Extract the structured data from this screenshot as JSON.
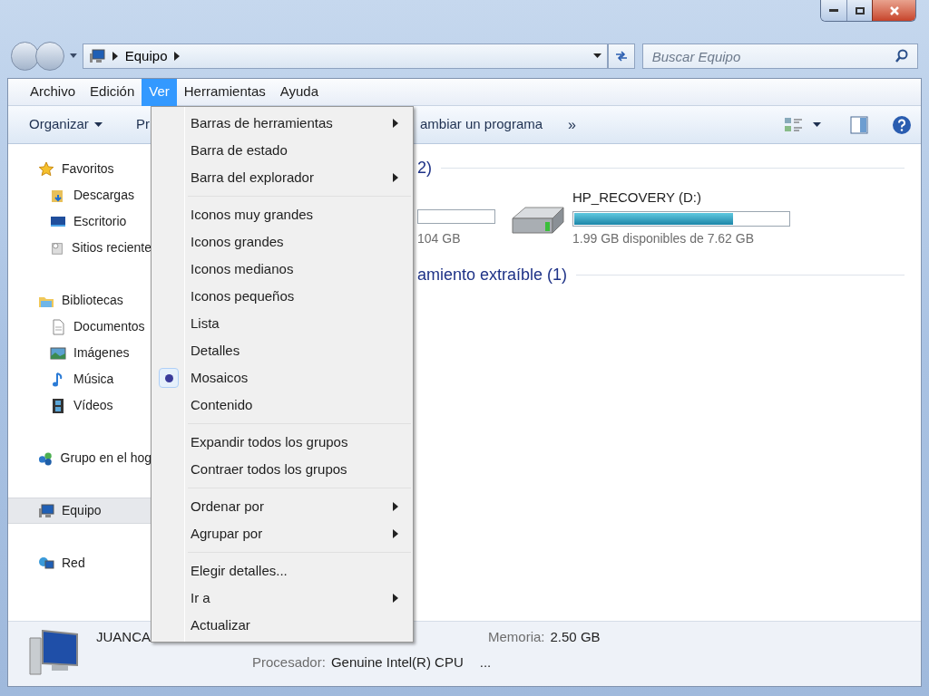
{
  "address": {
    "crumbs": [
      "Equipo"
    ]
  },
  "search": {
    "placeholder": "Buscar Equipo"
  },
  "menubar": [
    {
      "label": "Archivo",
      "selected": false
    },
    {
      "label": "Edición",
      "selected": false
    },
    {
      "label": "Ver",
      "selected": true
    },
    {
      "label": "Herramientas",
      "selected": false
    },
    {
      "label": "Ayuda",
      "selected": false
    }
  ],
  "toolbar": [
    {
      "label": "Organizar",
      "kind": "dropdown"
    },
    {
      "label": "Pr",
      "kind": "text"
    },
    {
      "label": "ambiar un programa",
      "kind": "text"
    },
    {
      "label": "»",
      "kind": "more"
    }
  ],
  "sidebar": [
    {
      "label": "Favoritos",
      "kind": "star",
      "selected": false,
      "children": [
        {
          "label": "Descargas",
          "kind": "download",
          "selected": false
        },
        {
          "label": "Escritorio",
          "kind": "desktop",
          "selected": false
        },
        {
          "label": "Sitios reciente",
          "kind": "recent",
          "selected": false
        }
      ]
    },
    {
      "label": "Bibliotecas",
      "kind": "library",
      "selected": false,
      "children": [
        {
          "label": "Documentos",
          "kind": "document",
          "selected": false
        },
        {
          "label": "Imágenes",
          "kind": "image",
          "selected": false
        },
        {
          "label": "Música",
          "kind": "music",
          "selected": false
        },
        {
          "label": "Vídeos",
          "kind": "video",
          "selected": false
        }
      ]
    },
    {
      "label": "Grupo en el hog",
      "kind": "homegroup",
      "selected": false
    },
    {
      "label": "Equipo",
      "kind": "computer",
      "selected": true
    },
    {
      "label": "Red",
      "kind": "network",
      "selected": false
    }
  ],
  "content": {
    "groups": [
      {
        "heading": "2)",
        "drives": [
          {
            "kind": "fragment",
            "info": "104 GB"
          },
          {
            "kind": "drive",
            "name": "HP_RECOVERY (D:)",
            "level": 0.74,
            "info": "1.99 GB disponibles de 7.62 GB"
          }
        ]
      },
      {
        "heading": "amiento extraíble (1)"
      }
    ]
  },
  "menu": [
    {
      "kind": "item",
      "label": "Barras de herramientas",
      "submenu": true,
      "selected": false
    },
    {
      "kind": "item",
      "label": "Barra de estado",
      "submenu": false,
      "selected": false
    },
    {
      "kind": "item",
      "label": "Barra del explorador",
      "submenu": true,
      "selected": false
    },
    {
      "kind": "separator"
    },
    {
      "kind": "item",
      "label": "Iconos muy grandes",
      "submenu": false,
      "selected": false
    },
    {
      "kind": "item",
      "label": "Iconos grandes",
      "submenu": false,
      "selected": false
    },
    {
      "kind": "item",
      "label": "Iconos medianos",
      "submenu": false,
      "selected": false
    },
    {
      "kind": "item",
      "label": "Iconos pequeños",
      "submenu": false,
      "selected": false
    },
    {
      "kind": "item",
      "label": "Lista",
      "submenu": false,
      "selected": false
    },
    {
      "kind": "item",
      "label": "Detalles",
      "submenu": false,
      "selected": false
    },
    {
      "kind": "item",
      "label": "Mosaicos",
      "submenu": false,
      "selected": true
    },
    {
      "kind": "item",
      "label": "Contenido",
      "submenu": false,
      "selected": false
    },
    {
      "kind": "separator"
    },
    {
      "kind": "item",
      "label": "Expandir todos los grupos",
      "submenu": false,
      "selected": false
    },
    {
      "kind": "item",
      "label": "Contraer todos los grupos",
      "submenu": false,
      "selected": false
    },
    {
      "kind": "separator"
    },
    {
      "kind": "item",
      "label": "Ordenar por",
      "submenu": true,
      "selected": false
    },
    {
      "kind": "item",
      "label": "Agrupar por",
      "submenu": true,
      "selected": false
    },
    {
      "kind": "separator"
    },
    {
      "kind": "item",
      "label": "Elegir detalles...",
      "submenu": false,
      "selected": false
    },
    {
      "kind": "item",
      "label": "Ir a",
      "submenu": true,
      "selected": false
    },
    {
      "kind": "item",
      "label": "Actualizar",
      "submenu": false,
      "selected": false
    }
  ],
  "details": {
    "name": "JUANCA",
    "memory_label": "Memoria:",
    "memory_value": "2.50 GB",
    "cpu_label": "Procesador:",
    "cpu_value": "Genuine Intel(R) CPU",
    "more": "..."
  }
}
